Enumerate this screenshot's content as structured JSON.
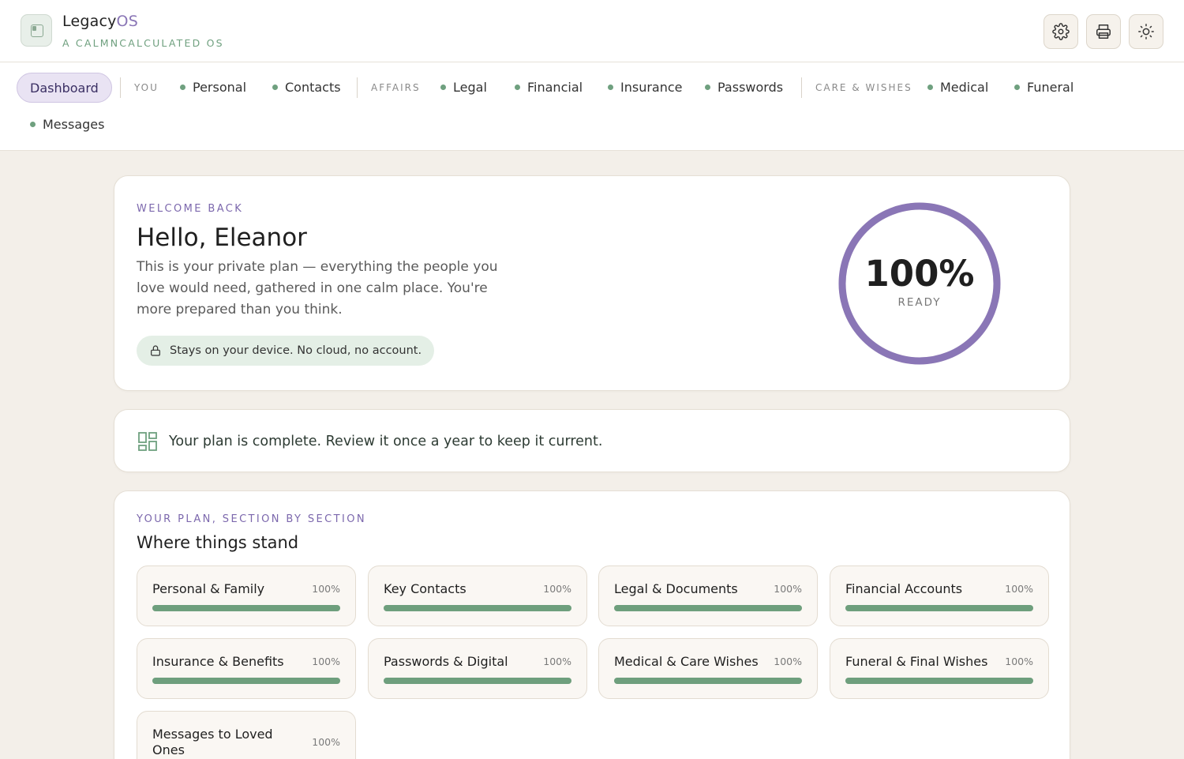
{
  "app": {
    "name": "Legacy",
    "name_suffix": "OS",
    "tagline": "A CALMNCALCULATED OS"
  },
  "header_buttons": [
    {
      "name": "settings",
      "icon": "gear-icon"
    },
    {
      "name": "print",
      "icon": "printer-icon"
    },
    {
      "name": "theme",
      "icon": "sun-icon"
    }
  ],
  "nav": {
    "dashboard": "Dashboard",
    "section_you": "YOU",
    "personal": "Personal",
    "contacts": "Contacts",
    "section_affairs": "AFFAIRS",
    "legal": "Legal",
    "financial": "Financial",
    "insurance": "Insurance",
    "passwords": "Passwords",
    "section_care": "CARE & WISHES",
    "medical": "Medical",
    "funeral": "Funeral",
    "messages": "Messages"
  },
  "welcome": {
    "eyebrow": "WELCOME BACK",
    "title": "Hello, Eleanor",
    "text": "This is your private plan — everything the people you love would need, gathered in one calm place. You're more prepared than you think.",
    "privacy": "Stays on your device. No cloud, no account.",
    "readiness_value": "100%",
    "readiness_fraction": 1.0,
    "readiness_label": "READY"
  },
  "status": {
    "text": "Your plan is complete. Review it once a year to keep it current."
  },
  "sections": {
    "eyebrow": "YOUR PLAN, SECTION BY SECTION",
    "title": "Where things stand",
    "items": [
      {
        "name": "Personal & Family",
        "pct": "100%",
        "progress": 1.0
      },
      {
        "name": "Key Contacts",
        "pct": "100%",
        "progress": 1.0
      },
      {
        "name": "Legal & Documents",
        "pct": "100%",
        "progress": 1.0
      },
      {
        "name": "Financial Accounts",
        "pct": "100%",
        "progress": 1.0
      },
      {
        "name": "Insurance & Benefits",
        "pct": "100%",
        "progress": 1.0
      },
      {
        "name": "Passwords & Digital",
        "pct": "100%",
        "progress": 1.0
      },
      {
        "name": "Medical & Care Wishes",
        "pct": "100%",
        "progress": 1.0
      },
      {
        "name": "Funeral & Final Wishes",
        "pct": "100%",
        "progress": 1.0
      },
      {
        "name": "Messages to Loved Ones",
        "pct": "100%",
        "progress": 1.0
      }
    ]
  },
  "colors": {
    "accent_purple": "#8a76b6",
    "accent_green": "#6e9f7d",
    "background": "#f3efe9"
  }
}
